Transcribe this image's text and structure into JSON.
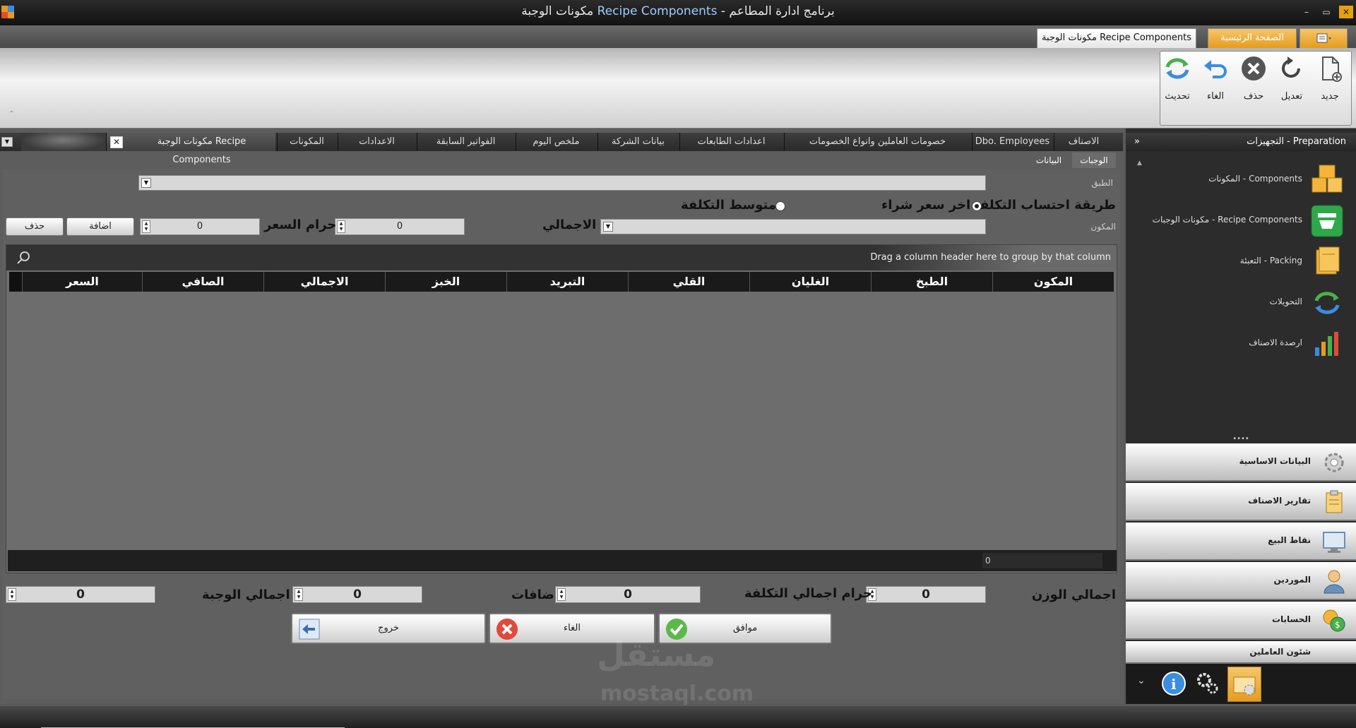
{
  "window": {
    "title_ar_part": "مكونات الوجبة",
    "title_en_part": "Recipe Components",
    "title_app": "- برنامج ادارة المطاعم",
    "min": "–",
    "max": "▭",
    "close": "✕"
  },
  "doc_tabs": {
    "active": "مكونات الوجبة Recipe Components",
    "home": "الصفحة الرئيسية"
  },
  "ribbon": {
    "buttons": [
      {
        "label": "جديد",
        "icon": "new-document-icon"
      },
      {
        "label": "تعديل",
        "icon": "edit-undo-icon"
      },
      {
        "label": "حذف",
        "icon": "delete-icon"
      },
      {
        "label": "الغاء",
        "icon": "cancel-arrow-icon"
      },
      {
        "label": "تحديث",
        "icon": "refresh-icon"
      }
    ],
    "collapse": "⌃"
  },
  "form_tabs": [
    "الاصناف",
    "Dbo. Employees",
    "خصومات العاملين وانواع الخصومات",
    "اعدادات الطابعات",
    "بيانات الشركة",
    "ملخص اليوم",
    "الفواتير السابقة",
    "الاعدادات",
    "المكونات",
    "مكونات الوجبة Recipe Components"
  ],
  "sub_tabs": [
    "الوجبات",
    "البيانات"
  ],
  "form": {
    "dish_label": "الطبق",
    "component_label": "المكون",
    "cost_method_label": "طريقة احتساب التكلفة",
    "last_price_option": "اخر سعر شراء",
    "avg_cost_option": "متوسط التكلفة",
    "total_label": "الاجمالي",
    "price_waste_label": "حرام السعر",
    "qty_value": "0",
    "price_value": "0",
    "add_btn": "اضافة",
    "delete_btn": "حذف"
  },
  "grid": {
    "group_hint": "Drag a column header here to group by that column",
    "columns": [
      "المكون",
      "الطبخ",
      "الغليان",
      "القلي",
      "التبريد",
      "الخبز",
      "الاجمالي",
      "الصافي",
      "السعر"
    ],
    "footer_sum": "0"
  },
  "totals": {
    "weight_label": "اجمالي الوزن",
    "weight_value": "0",
    "cost_label": "حرام اجمالي التكلفة",
    "cost_value": "0",
    "additions_label": "اضافات",
    "additions_value": "0",
    "meal_total_label": "اجمالي الوجبة",
    "meal_value_a": "0",
    "meal_value_b": "0"
  },
  "actions": {
    "ok": "موافق",
    "cancel": "الغاء",
    "exit": "خروج"
  },
  "watermark": {
    "ar": "مستقل",
    "en": "mostaql.com"
  },
  "nav": {
    "header": "التجهيزات - Preparation",
    "items": [
      {
        "label": "المكونات - Components",
        "icon": "boxes-icon"
      },
      {
        "label": "مكونات الوجبات - Recipe Components",
        "icon": "recipe-tray-icon"
      },
      {
        "label": "التعبئة - Packing",
        "icon": "packing-icon"
      },
      {
        "label": "التحويلات",
        "icon": "transfer-arrows-icon"
      },
      {
        "label": "ارصدة الاصناف",
        "icon": "bar-chart-icon"
      }
    ],
    "groups": [
      {
        "label": "البيانات الاساسية",
        "icon": "gear-icon"
      },
      {
        "label": "تقارير الاصناف",
        "icon": "clipboard-icon"
      },
      {
        "label": "نقاط البيع",
        "icon": "monitor-icon"
      },
      {
        "label": "الموردين",
        "icon": "person-icon"
      },
      {
        "label": "الحسابات",
        "icon": "coins-icon"
      },
      {
        "label": "شئون العاملين",
        "icon": "people-icon"
      }
    ]
  },
  "colors": {
    "accent_orange": "#e59c1e",
    "dark_bg": "#2c2c2c",
    "grid_bg": "#6d6d6d"
  }
}
